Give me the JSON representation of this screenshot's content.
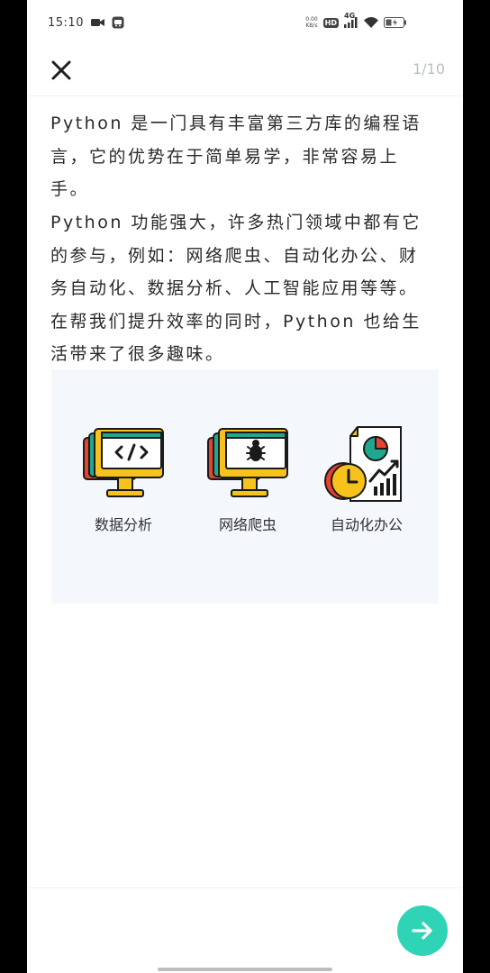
{
  "status_bar": {
    "time": "15:10",
    "net_speed_value": "0.00",
    "net_speed_unit": "KB/s",
    "hd_badge": "HD",
    "network_type": "4G",
    "icons": [
      "video-icon",
      "app-icon",
      "signal-icon",
      "wifi-icon",
      "battery-icon"
    ]
  },
  "header": {
    "close_icon": "close-icon",
    "page_counter": "1/10"
  },
  "content": {
    "paragraphs": [
      "Python 是一门具有丰富第三方库的编程语言，它的优势在于简单易学，非常容易上手。",
      "Python 功能强大，许多热门领域中都有它的参与，例如：网络爬虫、自动化办公、财务自动化、数据分析、人工智能应用等等。在帮我们提升效率的同时，Python 也给生活带来了很多趣味。"
    ],
    "features": [
      {
        "label": "数据分析",
        "icon": "code-monitor-icon"
      },
      {
        "label": "网络爬虫",
        "icon": "bug-monitor-icon"
      },
      {
        "label": "自动化办公",
        "icon": "report-clock-icon"
      }
    ]
  },
  "footer": {
    "next_icon": "arrow-right-icon"
  },
  "colors": {
    "accent": "#2fd4b6",
    "card_background": "#f4f7fb",
    "icon_teal": "#1fa88f",
    "icon_yellow": "#f7c21b",
    "icon_red": "#e8412e",
    "counter_gray": "#b9bdc2"
  }
}
